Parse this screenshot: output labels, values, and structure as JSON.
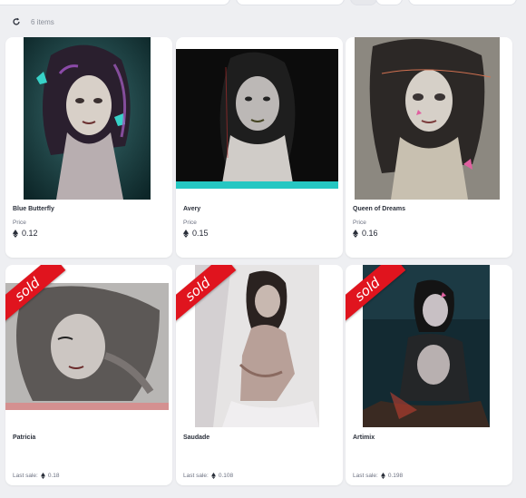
{
  "toolbar": {
    "count_label": "6 items",
    "refresh_icon": "refresh-icon"
  },
  "colors": {
    "sold_ribbon": "#e0141e",
    "card_bg": "#ffffff",
    "page_bg": "#eeeff2"
  },
  "items": [
    {
      "title": "Blue Butterfly",
      "price_label": "Price",
      "price": "0.12",
      "sold": false
    },
    {
      "title": "Avery",
      "price_label": "Price",
      "price": "0.15",
      "sold": false
    },
    {
      "title": "Queen of Dreams",
      "price_label": "Price",
      "price": "0.16",
      "sold": false
    },
    {
      "title": "Patricia",
      "last_sale_label": "Last sale:",
      "last_sale": "0.18",
      "sold": true,
      "sold_label": "sold"
    },
    {
      "title": "Saudade",
      "last_sale_label": "Last sale:",
      "last_sale": "0.108",
      "sold": true,
      "sold_label": "sold"
    },
    {
      "title": "Artimix",
      "last_sale_label": "Last sale:",
      "last_sale": "0.198",
      "sold": true,
      "sold_label": "sold"
    }
  ]
}
